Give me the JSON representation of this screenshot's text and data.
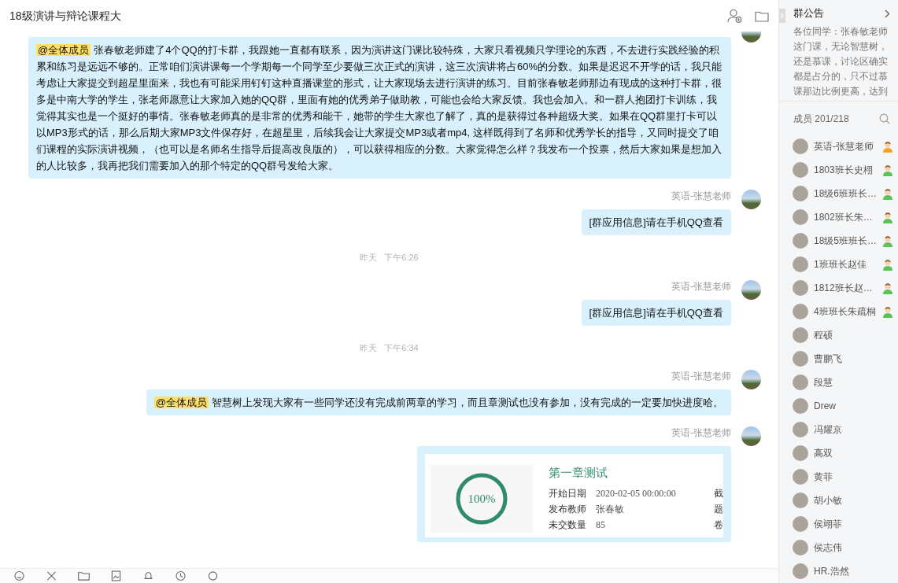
{
  "window": {
    "title": "18级演讲与辩论课程大"
  },
  "messages": [
    {
      "kind": "text",
      "mention": "@全体成员",
      "text": "张春敏老师建了4个QQ的打卡群，我跟她一直都有联系，因为演讲这门课比较特殊，大家只看视频只学理论的东西，不去进行实践经验的积累和练习是远远不够的。正常咱们演讲课每一个学期每一个同学至少要做三次正式的演讲，这三次演讲将占60%的分数。如果是迟迟不开学的话，我只能考虑让大家提交到超星里面来，我也有可能采用钉钉这种直播课堂的形式，让大家现场去进行演讲的练习。目前张春敏老师那边有现成的这种打卡群，很多是中南大学的学生，张老师愿意让大家加入她的QQ群，里面有她的优秀弟子做助教，可能也会给大家反馈。我也会加入。和一群人抱团打卡训练，我觉得其实也是一个挺好的事情。张春敏老师真的是非常的优秀和能干，她带的学生大家也了解了，真的是获得过各种超级大奖。如果在QQ群里打卡可以以MP3形式的话，那么后期大家MP3文件保存好，在超星里，后续我会让大家提交MP3或者mp4, 这样既得到了名师和优秀学长的指导，又同时提交了咱们课程的实际演讲视频，（也可以是名师名生指导后提高改良版的），可以获得相应的分数。大家觉得怎么样？我发布一个投票，然后大家如果是想加入的人比较多，我再把我们需要加入的那个特定的QQ群号发给大家。"
    },
    {
      "kind": "text",
      "sender": "英语-张慧老师",
      "text": "[群应用信息]请在手机QQ查看"
    },
    {
      "kind": "time",
      "day": "昨天",
      "time": "下午6:26"
    },
    {
      "kind": "text",
      "sender": "英语-张慧老师",
      "text": "[群应用信息]请在手机QQ查看"
    },
    {
      "kind": "time",
      "day": "昨天",
      "time": "下午6:34"
    },
    {
      "kind": "text",
      "sender": "英语-张慧老师",
      "mention": "@全体成员",
      "text": "智慧树上发现大家有一些同学还没有完成前两章的学习，而且章测试也没有参加，没有完成的一定要加快进度哈。"
    },
    {
      "kind": "card",
      "sender": "英语-张慧老师",
      "title": "第一章测试",
      "progress": "100%",
      "level": 1,
      "fields": [
        {
          "label": "开始日期",
          "value": "2020-02-05 00:00:00",
          "column_3": "截"
        },
        {
          "label": "发布教师",
          "value": "张春敏",
          "column_3": "题"
        },
        {
          "label": "未交数量",
          "value": "85",
          "column_3": "卷"
        }
      ]
    }
  ],
  "sidebar": {
    "notice": {
      "title": "群公告",
      "text": "各位同学：张春敏老师这门课，无论智慧树，还是慕课，讨论区确实都是占分的，只不过慕课那边比例更高，达到"
    },
    "members_label": "成员 201/218",
    "members": [
      {
        "name": "英语-张慧老师",
        "kind": "owner"
      },
      {
        "name": "1803班长史栩",
        "kind": "admin"
      },
      {
        "name": "18级6班班长…",
        "kind": "admin"
      },
      {
        "name": "1802班长朱…",
        "kind": "admin"
      },
      {
        "name": "18级5班班长…",
        "kind": "admin"
      },
      {
        "name": "1班班长赵佳",
        "kind": "admin"
      },
      {
        "name": "1812班长赵…",
        "kind": "admin"
      },
      {
        "name": "4班班长朱疏桐",
        "kind": "admin"
      },
      {
        "name": "程硕",
        "kind": "member"
      },
      {
        "name": "曹鹏飞",
        "kind": "member"
      },
      {
        "name": "段慧",
        "kind": "member"
      },
      {
        "name": "Drew",
        "kind": "member"
      },
      {
        "name": "冯耀京",
        "kind": "member"
      },
      {
        "name": "高双",
        "kind": "member"
      },
      {
        "name": "黄菲",
        "kind": "member"
      },
      {
        "name": "胡小敏",
        "kind": "member"
      },
      {
        "name": "侯翊菲",
        "kind": "member"
      },
      {
        "name": "侯志伟",
        "kind": "member"
      },
      {
        "name": "HR.浩然",
        "kind": "member"
      }
    ]
  }
}
